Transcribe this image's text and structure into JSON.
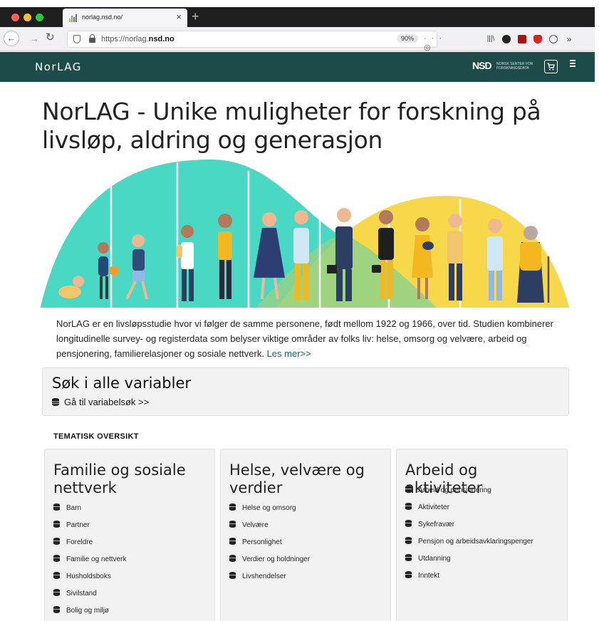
{
  "browser": {
    "tab_title": "norlag.nsd.no/",
    "tab_close": "×",
    "new_tab": "+",
    "url_prefix": "https://norlag.",
    "url_domain": "nsd.no",
    "zoom": "90%",
    "url_actions": "··· ◎ ☆"
  },
  "header": {
    "brand": "NorLAG",
    "logo": "NSD",
    "logo_subtitle": "NORSK SENTER FOR FORSKNINGSDATA"
  },
  "page": {
    "title": "NorLAG - Unike muligheter for forskning på livsløp, aldring og generasjon",
    "intro": "NorLAG er en livsløpsstudie hvor vi følger de samme personene, født mellom 1922 og 1966, over tid. Studien kombinerer longitudinelle survey- og registerdata som belyser viktige områder av folks liv: helse, omsorg og velvære, arbeid og pensjonering, familierelasjoner og sosiale nettverk.",
    "read_more": "Les mer>>"
  },
  "search": {
    "title": "Søk i alle variabler",
    "link": "Gå til variabelsøk >>"
  },
  "thematic": {
    "label": "TEMATISK OVERSIKT",
    "cards": [
      {
        "title": "Familie og sosiale nettverk",
        "items": [
          "Barn",
          "Partner",
          "Foreldre",
          "Familie og nettverk",
          "Husholdsboks",
          "Sivilstand",
          "Bolig og miljø"
        ]
      },
      {
        "title": "Helse, velvære og verdier",
        "items": [
          "Helse og omsorg",
          "Velvære",
          "Personlighet",
          "Verdier og holdninger",
          "Livshendelser"
        ]
      },
      {
        "title": "Arbeid og aktiviteter",
        "items": [
          "Arbeid og pensjonering",
          "Aktiviteter",
          "Sykefravær",
          "Pensjon og arbeidsavklaringspenger",
          "Utdanning",
          "Inntekt"
        ]
      }
    ]
  },
  "colors": {
    "header_bg": "#1d4b4a",
    "hero_teal": "#49d8c4",
    "hero_yellow": "#f7d84a",
    "hero_green": "#8ed28a",
    "link": "#1d5a6a"
  }
}
